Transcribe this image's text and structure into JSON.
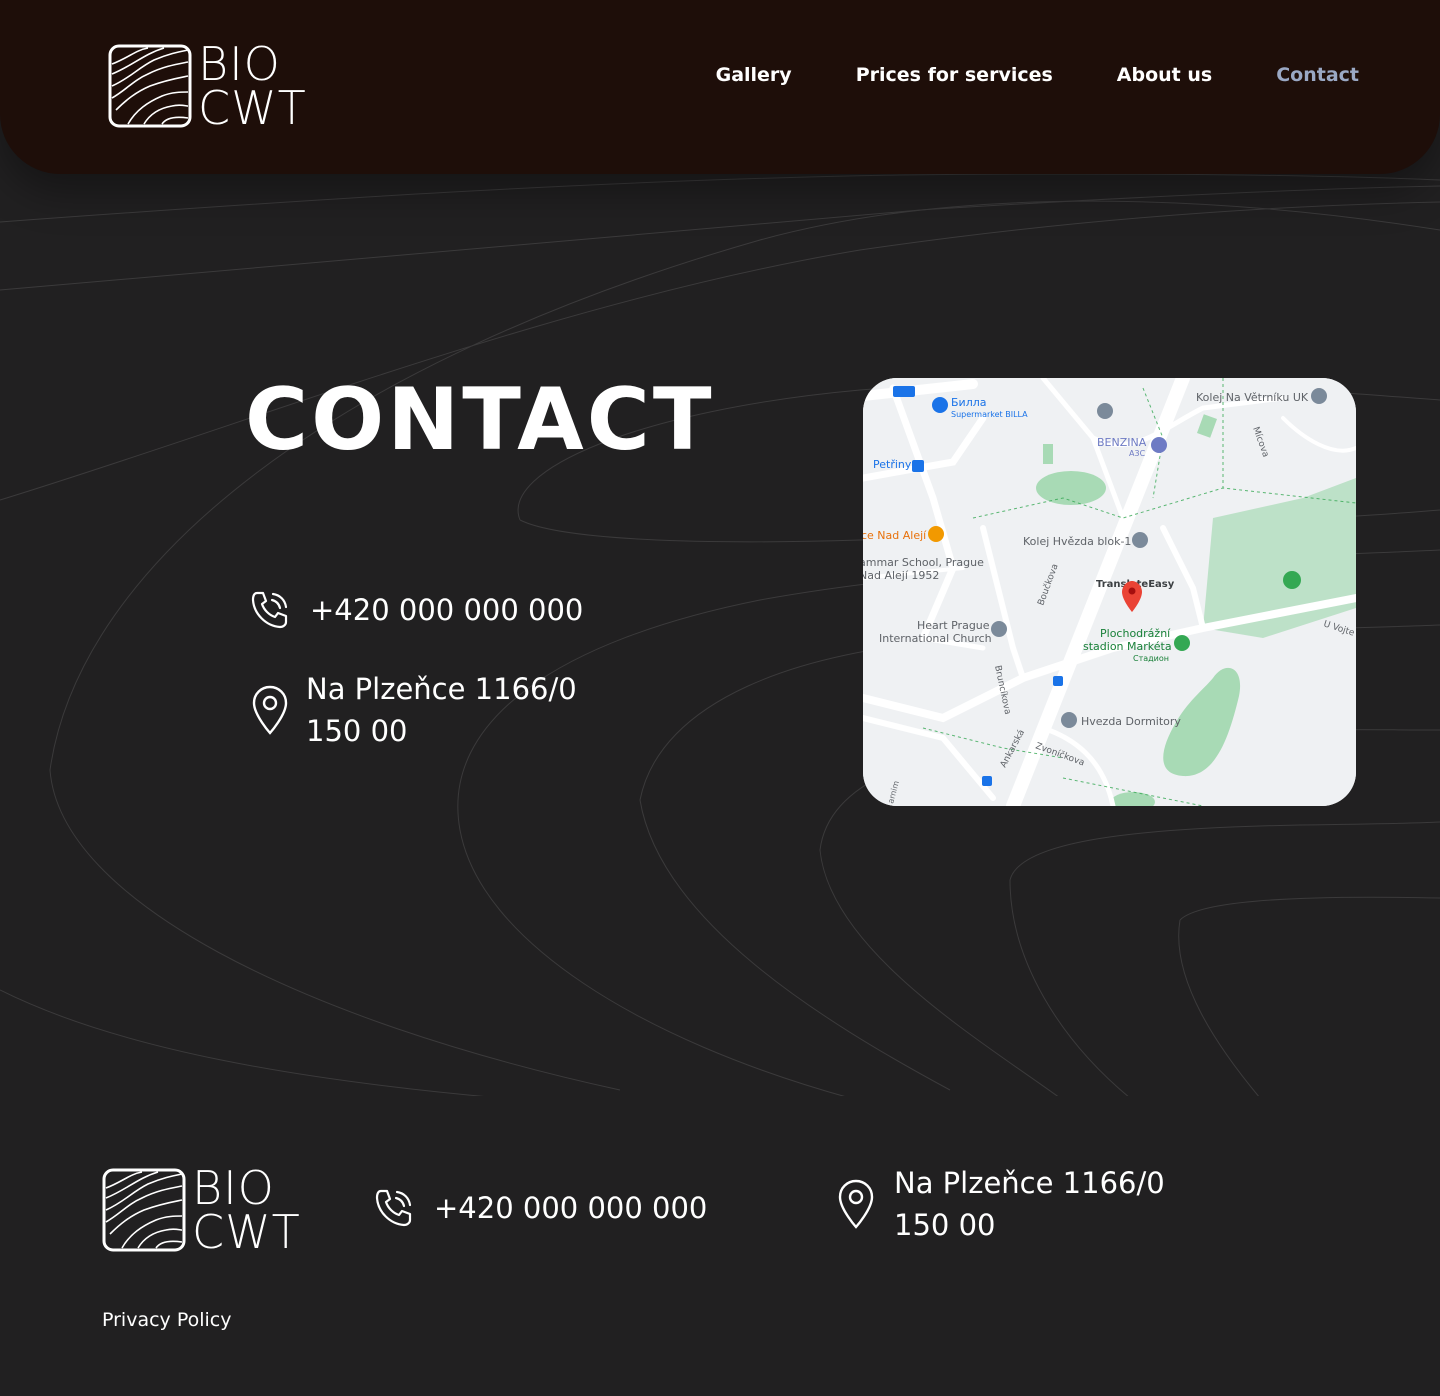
{
  "brand": {
    "line1": "BIO",
    "line2": "CWT"
  },
  "nav": {
    "items": [
      {
        "label": "Gallery"
      },
      {
        "label": "Prices for services"
      },
      {
        "label": "About us"
      },
      {
        "label": "Contact",
        "active": true
      }
    ]
  },
  "page": {
    "title": "CONTACT",
    "phone": "+420 000 000 000",
    "address_line1": "Na Plzeňce 1166/0",
    "address_line2": "150 00"
  },
  "map": {
    "labels": {
      "billa": "Билла",
      "billa_sub": "Supermarket BILLA",
      "kolej_vetrniku": "Kolej Na Větrníku UK",
      "benzina": "BENZINA",
      "benzina_sub": "A3C",
      "petriny": "Petřiny",
      "micova": "Mícova",
      "nad_aleji": "ce Nad Alejí",
      "kolej_hvezda": "Kolej Hvězda blok-1",
      "school": "ammar School, Prague",
      "school_sub": "Nad Alejí 1952",
      "bouckova": "Boučkova",
      "translateeasy": "TranslateEasy",
      "church": "Heart Prague",
      "church_sub": "International Church",
      "stadion": "Plochodrážní",
      "stadion2": "stadion Markéta",
      "stadion_sub": "Стадион",
      "u_vojte": "U Vojte",
      "bruncikova": "Bruncíkova",
      "dormitory": "Hvezda Dormitory",
      "ankarska": "Ankarská",
      "zvonickova": "Zvoníčkova",
      "arnim": "arnim"
    },
    "colors": {
      "land": "#eff1f3",
      "park": "#a8dab5",
      "road": "#ffffff",
      "label": "#5f6368",
      "green_label": "#188038",
      "blue_label": "#1a73e8",
      "orange_label": "#e8710a",
      "pin": "#ea4335"
    }
  },
  "footer": {
    "phone": "+420 000 000 000",
    "address_line1": "Na Plzeňce 1166/0",
    "address_line2": "150 00",
    "privacy": "Privacy Policy"
  },
  "colors": {
    "header_bg": "#1e0e09",
    "page_bg": "#212021",
    "nav_active": "#9aa8c4",
    "text": "#ffffff"
  },
  "icons": {
    "phone": "phone-icon",
    "location": "location-pin-icon",
    "logo": "topographic-logo-icon"
  }
}
